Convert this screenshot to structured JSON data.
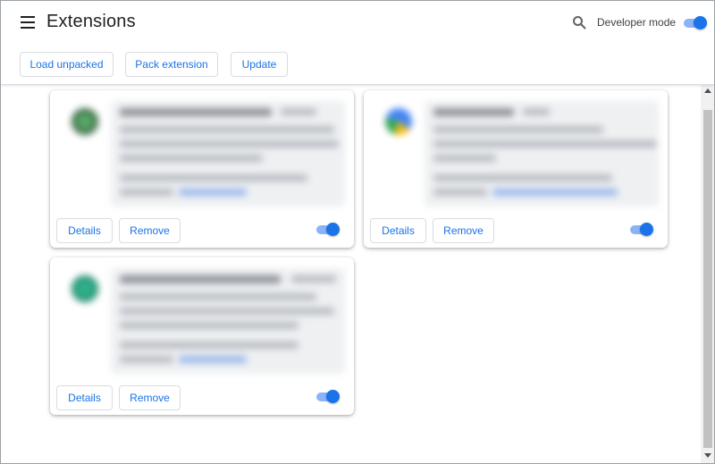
{
  "header": {
    "title": "Extensions",
    "developer_mode_label": "Developer mode",
    "developer_mode_on": true
  },
  "toolbar": {
    "load_unpacked_label": "Load unpacked",
    "pack_extension_label": "Pack extension",
    "update_label": "Update"
  },
  "cards": [
    {
      "details_label": "Details",
      "remove_label": "Remove",
      "enabled": true,
      "icon_color": "#3f7d4a"
    },
    {
      "details_label": "Details",
      "remove_label": "Remove",
      "enabled": true,
      "icon_color": "#4285f4"
    },
    {
      "details_label": "Details",
      "remove_label": "Remove",
      "enabled": true,
      "icon_color": "#1e8a70"
    }
  ],
  "colors": {
    "accent": "#1a73e8",
    "toggle_track": "#8ab4f8",
    "border": "#dadce0"
  }
}
